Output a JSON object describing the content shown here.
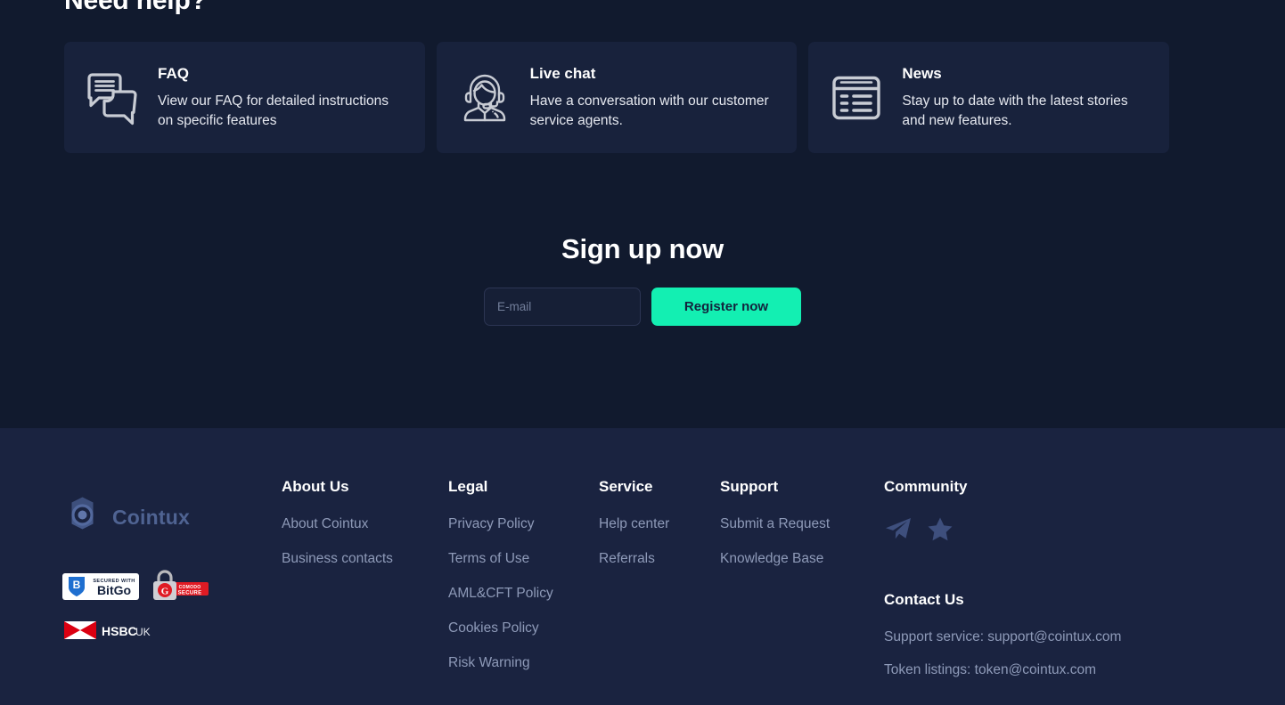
{
  "help": {
    "heading": "Need help?",
    "cards": [
      {
        "icon": "chat-bubbles-icon",
        "title": "FAQ",
        "desc": "View our FAQ for detailed instructions on specific features"
      },
      {
        "icon": "support-agent-headset-icon",
        "title": "Live chat",
        "desc": "Have a conversation with our customer service agents."
      },
      {
        "icon": "news-list-icon",
        "title": "News",
        "desc": "Stay up to date with the latest stories and new features."
      }
    ]
  },
  "signup": {
    "title": "Sign up now",
    "email_placeholder": "E-mail",
    "email_value": "",
    "register_label": "Register now",
    "button_color": "#13efb2"
  },
  "footer": {
    "brand": {
      "name": "Cointux",
      "logo_icon": "cointux-logo-icon",
      "color": "#4f6392"
    },
    "badges": [
      {
        "name": "bitgo-badge",
        "tagline": "SECURED WITH",
        "label": "BitGo",
        "color": "#1f6fd0"
      },
      {
        "name": "comodo-secure-badge",
        "label": "COMODO",
        "sublabel": "SECURE",
        "color": "#e01b24"
      },
      {
        "name": "hsbc-uk-badge",
        "label": "HSBC",
        "sublabel": "UK",
        "color": "#db0011"
      }
    ],
    "columns": [
      {
        "title": "About Us",
        "links": [
          "About Cointux",
          "Business contacts"
        ]
      },
      {
        "title": "Legal",
        "links": [
          "Privacy Policy",
          "Terms of Use",
          "AML&CFT Policy",
          "Cookies Policy",
          "Risk Warning"
        ]
      },
      {
        "title": "Service",
        "links": [
          "Help center",
          "Referrals"
        ]
      },
      {
        "title": "Support",
        "links": [
          "Submit a Request",
          "Knowledge Base"
        ]
      }
    ],
    "community": {
      "title": "Community",
      "icons": [
        "telegram-icon",
        "star-icon"
      ]
    },
    "contact": {
      "title": "Contact Us",
      "lines": [
        "Support service: support@cointux.com",
        "Token listings: token@cointux.com"
      ]
    }
  }
}
